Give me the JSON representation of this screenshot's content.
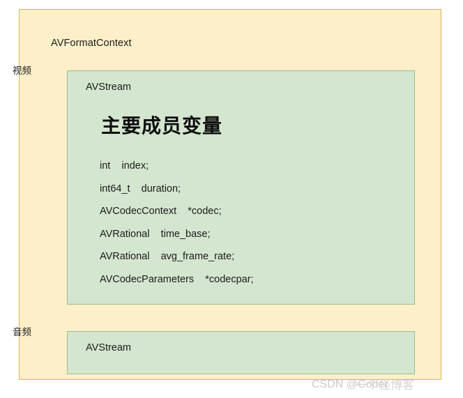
{
  "diagram": {
    "outer": {
      "label": "AVFormatContext",
      "fill_color": "#FDEFC9",
      "border_color": "#D6B656"
    },
    "side_labels": {
      "video": "视频",
      "audio": "音频"
    },
    "streams": [
      {
        "label": "AVStream",
        "fill_color": "#D4E6CF",
        "border_color": "#9CBE8C",
        "heading": "主要成员变量",
        "members": [
          "int    index;",
          "int64_t    duration;",
          "AVCodecContext    *codec;",
          "AVRational    time_base;",
          "AVRational    avg_frame_rate;",
          "AVCodecParameters    *codecpar;"
        ]
      },
      {
        "label": "AVStream",
        "fill_color": "#D4E6CF",
        "border_color": "#9CBE8C",
        "heading": "",
        "members": []
      }
    ]
  },
  "watermark": {
    "text": "CSDN @Coder",
    "overlay": "一个怪博客"
  }
}
